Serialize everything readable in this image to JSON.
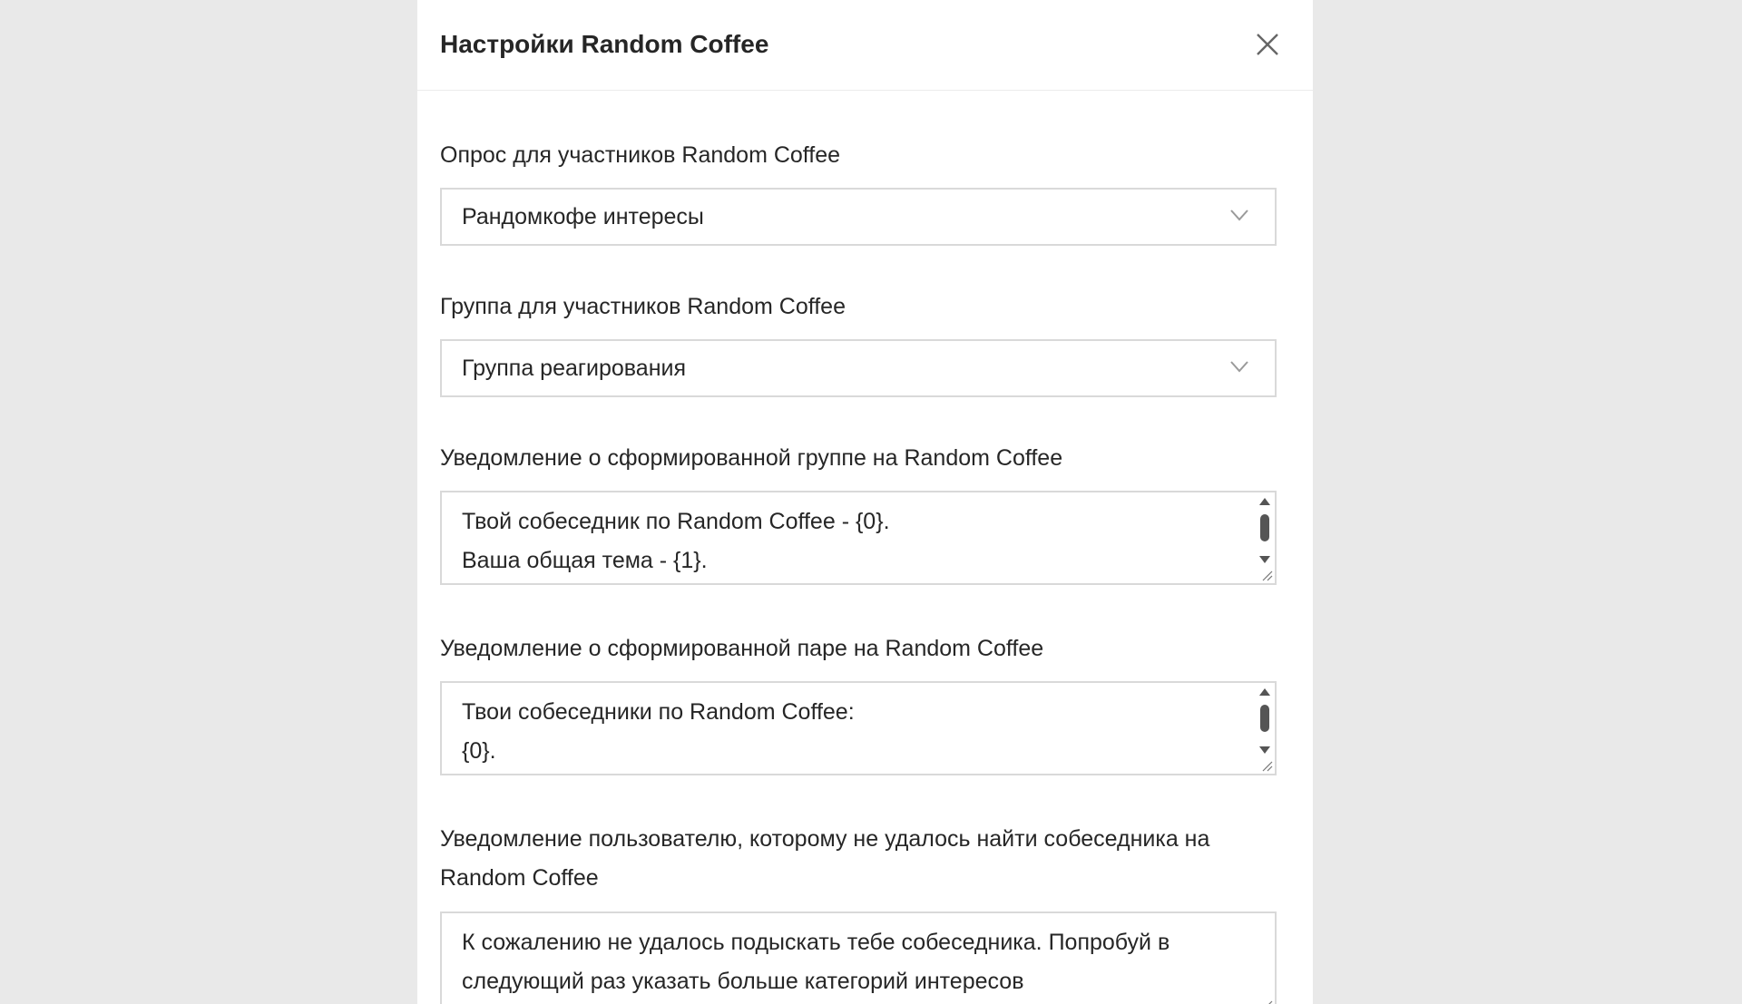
{
  "modal": {
    "title": "Настройки Random Coffee"
  },
  "fields": {
    "survey": {
      "label": "Опрос для участников Random Coffee",
      "value": "Рандомкофе интересы"
    },
    "group": {
      "label": "Группа для участников Random Coffee",
      "value": "Группа реагирования"
    },
    "group_notification": {
      "label": "Уведомление о сформированной группе на Random Coffee",
      "value": "Твой собеседник по Random Coffee - {0}.\nВаша общая тема - {1}."
    },
    "pair_notification": {
      "label": "Уведомление о сформированной паре на Random Coffee",
      "value": "Твои собеседники по Random Coffee:\n{0}."
    },
    "no_match_notification": {
      "label": "Уведомление пользователю, которому не удалось найти собеседника на Random Coffee",
      "value": "К сожалению не удалось подыскать тебе собеседника. Попробуй в следующий раз указать больше категорий интересов"
    }
  },
  "icons": {
    "close": "close-icon",
    "dropdown": "chevron-down-icon"
  },
  "colors": {
    "background": "#e9e9e9",
    "panel": "#ffffff",
    "border": "#d9d9d9",
    "text": "#262626"
  }
}
